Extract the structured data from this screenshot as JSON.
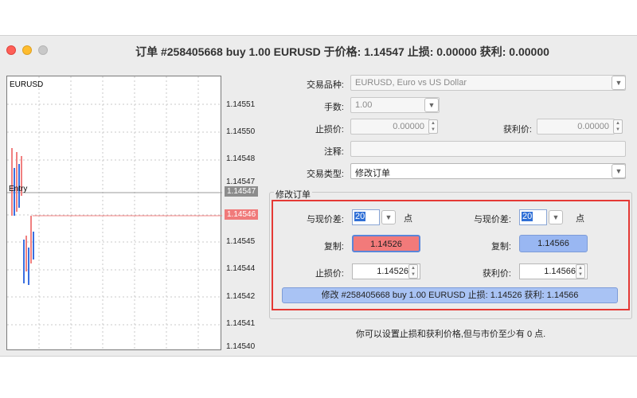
{
  "window": {
    "title": "订单 #258405668 buy 1.00 EURUSD 于价格: 1.14547 止损: 0.00000 获利: 0.00000"
  },
  "chart": {
    "symbol": "EURUSD",
    "entry_label": "Entry",
    "y_ticks": [
      "1.14551",
      "1.14550",
      "1.14548",
      "1.14547",
      "1.14546",
      "1.14545",
      "1.14544",
      "1.14542",
      "1.14541",
      "1.14540"
    ],
    "current_price_tag": "1.14547",
    "stop_price_tag": "1.14546",
    "tag_colors": {
      "entry": "#8c8c8c",
      "stop": "#f07a7a"
    }
  },
  "form": {
    "symbol_label": "交易品种:",
    "symbol_value": "EURUSD, Euro vs US Dollar",
    "volume_label": "手数:",
    "volume_value": "1.00",
    "sl_label": "止损价:",
    "sl_value": "0.00000",
    "tp_label": "获利价:",
    "tp_value": "0.00000",
    "comment_label": "注释:",
    "comment_value": "",
    "type_label": "交易类型:",
    "type_value": "修改订单"
  },
  "modify_group": {
    "title": "修改订单",
    "left": {
      "diff_label": "与现价差:",
      "diff_value": "20",
      "unit": "点",
      "copy_label": "复制:",
      "copy_value": "1.14526",
      "price_label": "止损价:",
      "price_value": "1.14526"
    },
    "right": {
      "diff_label": "与现价差:",
      "diff_value": "20",
      "unit": "点",
      "copy_label": "复制:",
      "copy_value": "1.14566",
      "price_label": "获利价:",
      "price_value": "1.14566"
    },
    "modify_button": "修改 #258405668 buy 1.00 EURUSD 止损: 1.14526 获利: 1.14566"
  },
  "note": "你可以设置止损和获利价格,但与市价至少有 0 点.",
  "colors": {
    "highlight": "#e53935",
    "copy_red": "#f27a7a",
    "copy_blue": "#99b7f2"
  }
}
